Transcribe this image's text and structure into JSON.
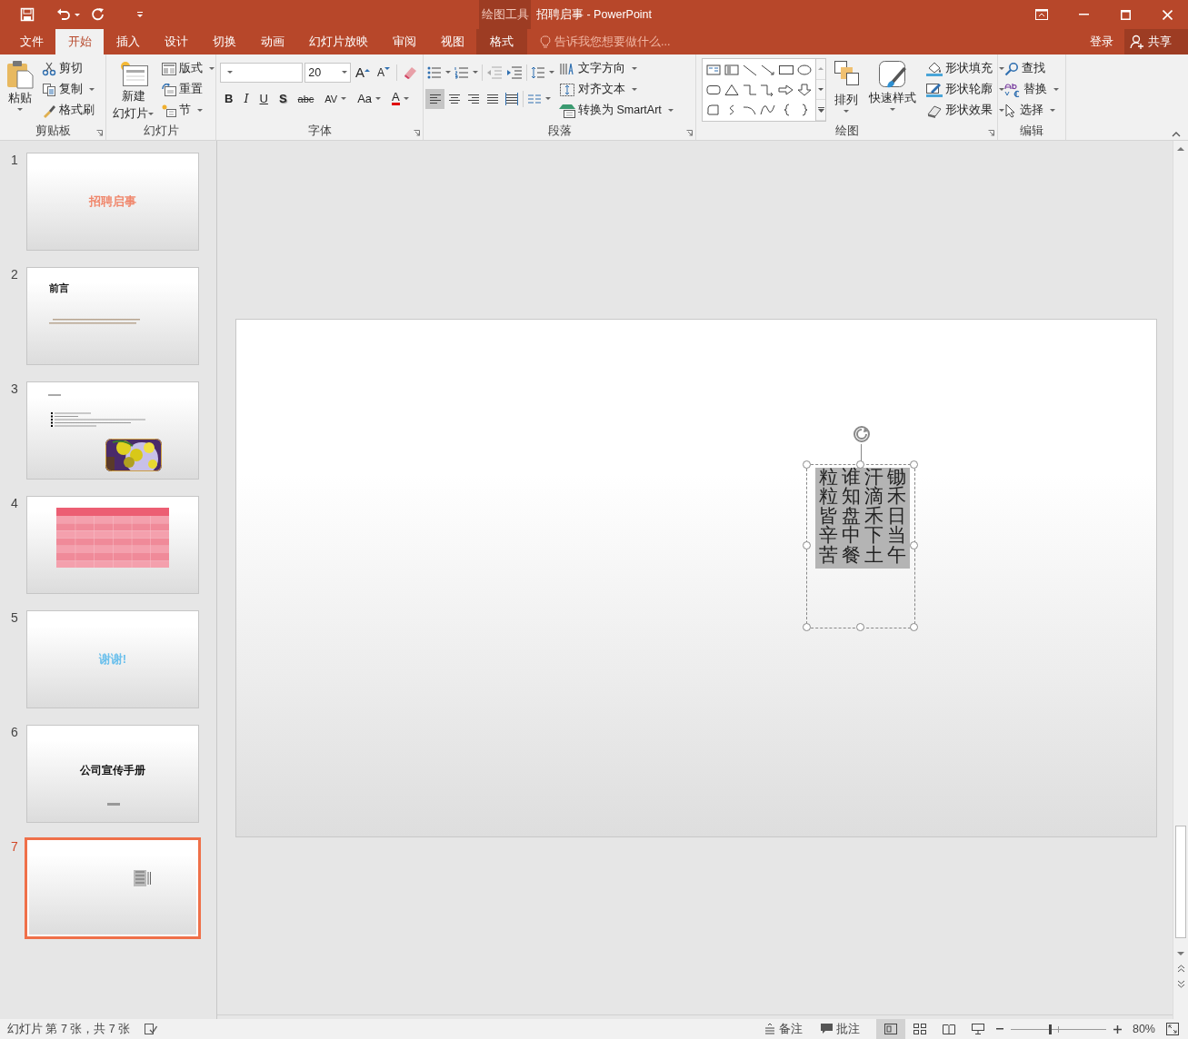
{
  "window": {
    "title": "招聘启事 - PowerPoint",
    "context_group": "绘图工具"
  },
  "tabs": [
    {
      "label": "文件",
      "selected": false,
      "kind": "file"
    },
    {
      "label": "开始",
      "selected": true,
      "kind": "main"
    },
    {
      "label": "插入",
      "selected": false,
      "kind": "main"
    },
    {
      "label": "设计",
      "selected": false,
      "kind": "main"
    },
    {
      "label": "切换",
      "selected": false,
      "kind": "main"
    },
    {
      "label": "动画",
      "selected": false,
      "kind": "main"
    },
    {
      "label": "幻灯片放映",
      "selected": false,
      "kind": "main"
    },
    {
      "label": "审阅",
      "selected": false,
      "kind": "main"
    },
    {
      "label": "视图",
      "selected": false,
      "kind": "main"
    },
    {
      "label": "格式",
      "selected": false,
      "kind": "contextual"
    }
  ],
  "tell_me": {
    "placeholder": "告诉我您想要做什么..."
  },
  "account": {
    "sign_in": "登录",
    "share": "共享"
  },
  "ribbon": {
    "clipboard": {
      "label": "剪贴板",
      "paste": "粘贴",
      "cut": "剪切",
      "copy": "复制",
      "format_painter": "格式刷"
    },
    "slides": {
      "label": "幻灯片",
      "new_slide": [
        "新建",
        "幻灯片"
      ],
      "layout": "版式",
      "reset": "重置",
      "section": "节"
    },
    "font": {
      "label": "字体",
      "size": "20",
      "grow": "A",
      "shrink": "A",
      "styles": [
        {
          "kind": "bold",
          "label": "B"
        },
        {
          "kind": "italic",
          "label": "I"
        },
        {
          "kind": "underline",
          "label": "U"
        },
        {
          "kind": "shadow",
          "label": "S"
        },
        {
          "kind": "strike",
          "label": "abc"
        },
        {
          "kind": "spacing",
          "label": "AV"
        },
        {
          "kind": "case",
          "label": "Aa"
        },
        {
          "kind": "color",
          "label": "A"
        }
      ]
    },
    "paragraph": {
      "label": "段落",
      "text_direction": "文字方向",
      "align_text": "对齐文本",
      "smartart": "转换为 SmartArt",
      "alignments": [
        {
          "kind": "left",
          "selected": true
        },
        {
          "kind": "center",
          "selected": false
        },
        {
          "kind": "right",
          "selected": false
        },
        {
          "kind": "justify",
          "selected": false
        },
        {
          "kind": "distributed",
          "selected": false
        }
      ]
    },
    "drawing": {
      "label": "绘图",
      "arrange": "排列",
      "quick_styles": "快速样式",
      "fill": "形状填充",
      "outline": "形状轮廓",
      "effects": "形状效果"
    },
    "editing": {
      "label": "编辑",
      "find": "查找",
      "replace": "替换",
      "select": "选择"
    }
  },
  "slides": [
    {
      "number": "1",
      "selected": false,
      "kind": "title",
      "title": "招聘启事",
      "color": "#f0876c"
    },
    {
      "number": "2",
      "selected": false,
      "kind": "heading",
      "title": "前言"
    },
    {
      "number": "3",
      "selected": false,
      "kind": "bullets"
    },
    {
      "number": "4",
      "selected": false,
      "kind": "table"
    },
    {
      "number": "5",
      "selected": false,
      "kind": "title",
      "title": "谢谢!",
      "color": "#6cc0ec"
    },
    {
      "number": "6",
      "selected": false,
      "kind": "cover",
      "title": "公司宣传手册",
      "color": "#111111"
    },
    {
      "number": "7",
      "selected": true,
      "kind": "vertical"
    }
  ],
  "editor": {
    "text_columns": [
      "粒粒皆辛苦",
      "谁知盘中餐",
      "汗滴禾下土",
      "锄禾日当午"
    ]
  },
  "status_bar": {
    "slide_info": "幻灯片 第 7 张，共 7 张",
    "notes": "备注",
    "comments": "批注",
    "views": [
      {
        "kind": "normal",
        "selected": true
      },
      {
        "kind": "sorter",
        "selected": false
      },
      {
        "kind": "reading",
        "selected": false
      },
      {
        "kind": "slideshow",
        "selected": false
      }
    ],
    "zoom": {
      "level": 0.41,
      "reading": "80%"
    }
  }
}
